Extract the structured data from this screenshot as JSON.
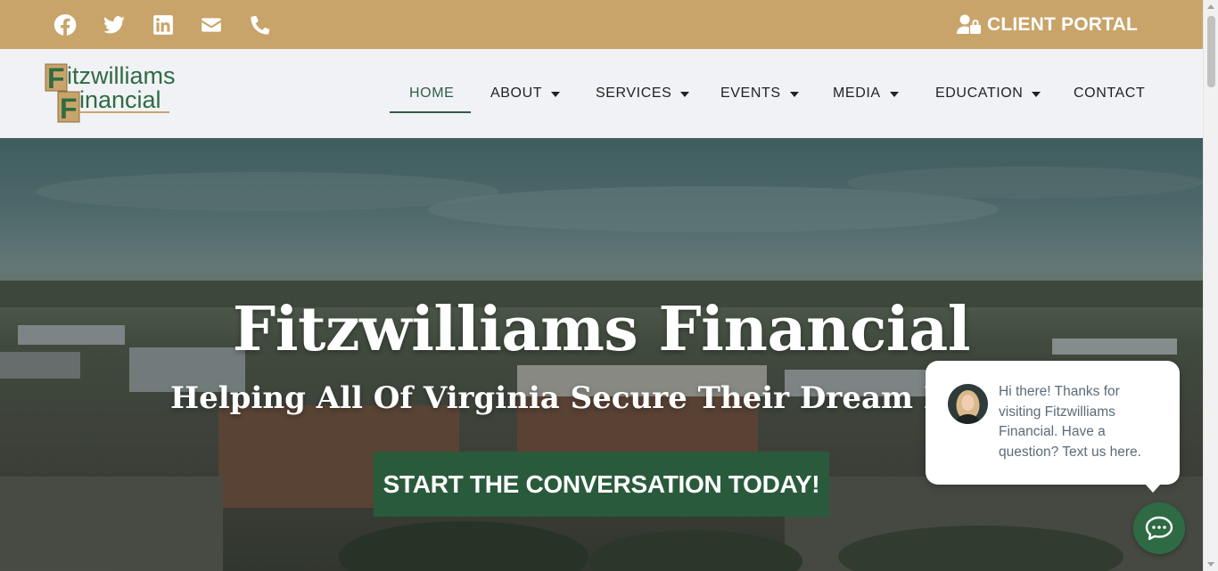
{
  "topbar": {
    "social": [
      {
        "name": "facebook-icon"
      },
      {
        "name": "twitter-icon"
      },
      {
        "name": "linkedin-icon"
      },
      {
        "name": "email-icon"
      },
      {
        "name": "phone-icon"
      }
    ],
    "portal_label": "CLIENT PORTAL",
    "bg_color": "#c9a46a"
  },
  "logo": {
    "line1": "itzwilliams",
    "line2": "inancial",
    "letter": "F"
  },
  "nav": {
    "items": [
      {
        "label": "HOME",
        "active": true,
        "dropdown": false
      },
      {
        "label": "ABOUT",
        "active": false,
        "dropdown": true
      },
      {
        "label": "SERVICES",
        "active": false,
        "dropdown": true
      },
      {
        "label": "EVENTS",
        "active": false,
        "dropdown": true
      },
      {
        "label": "MEDIA",
        "active": false,
        "dropdown": true
      },
      {
        "label": "EDUCATION",
        "active": false,
        "dropdown": true
      },
      {
        "label": "CONTACT",
        "active": false,
        "dropdown": false
      }
    ],
    "accent_color": "#2f5e45"
  },
  "hero": {
    "title": "Fitzwilliams Financial",
    "subtitle": "Helping All Of Virginia Secure Their Dream Retirement",
    "cta_label": "START THE CONVERSATION TODAY!",
    "cta_color": "#2a5a3c"
  },
  "chat": {
    "message": "Hi there! Thanks for visiting Fitzwilliams Financial. Have a question? Text us here.",
    "button_color": "#2e6b45"
  }
}
